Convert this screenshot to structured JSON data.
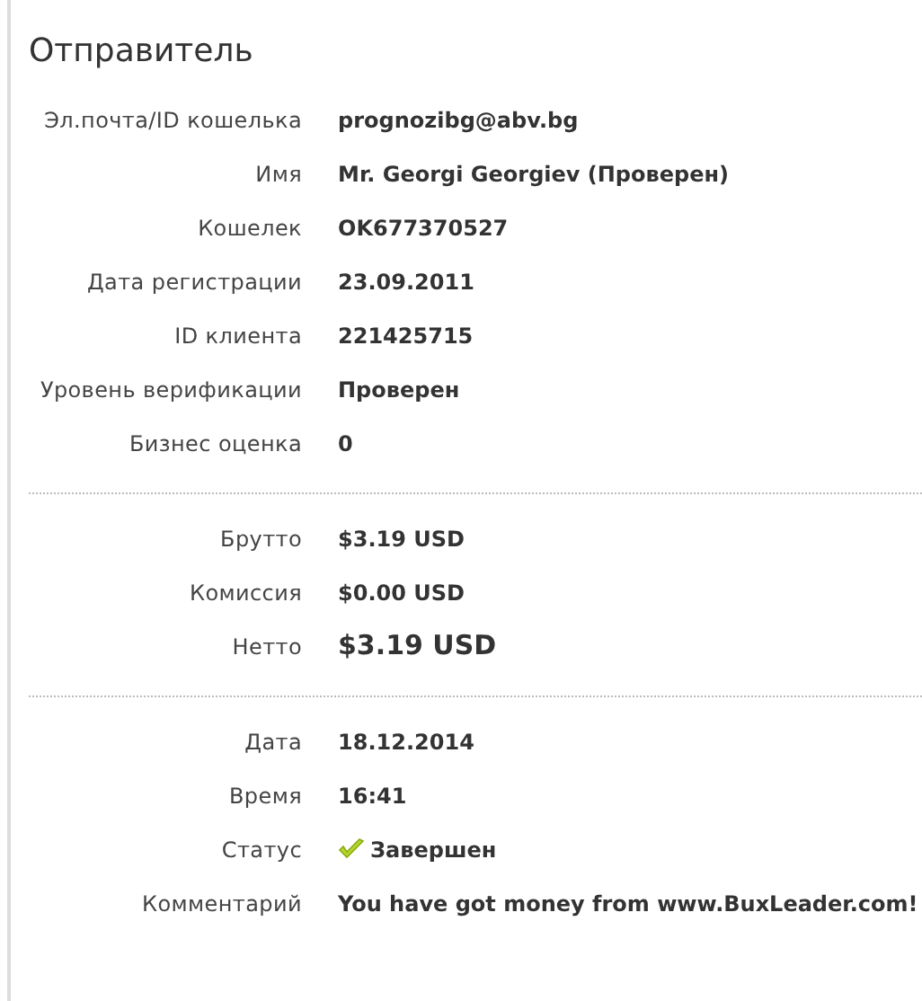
{
  "title": "Отправитель",
  "sections": [
    {
      "rows": [
        {
          "label": "Эл.почта/ID кошелька",
          "value": "prognozibg@abv.bg",
          "kind": "text"
        },
        {
          "label": "Имя",
          "value": "Mr. Georgi Georgiev (Проверен)",
          "kind": "text"
        },
        {
          "label": "Кошелек",
          "value": "OK677370527",
          "kind": "text"
        },
        {
          "label": "Дата регистрации",
          "value": "23.09.2011",
          "kind": "text"
        },
        {
          "label": "ID клиента",
          "value": "221425715",
          "kind": "text"
        },
        {
          "label": "Уровень верификации",
          "value": "Проверен",
          "kind": "text"
        },
        {
          "label": "Бизнес оценка",
          "value": "0",
          "kind": "text"
        }
      ]
    },
    {
      "rows": [
        {
          "label": "Брутто",
          "value": "$3.19 USD",
          "kind": "text"
        },
        {
          "label": "Комиссия",
          "value": "$0.00 USD",
          "kind": "text"
        },
        {
          "label": "Нетто",
          "value": "$3.19 USD",
          "kind": "large"
        }
      ]
    },
    {
      "rows": [
        {
          "label": "Дата",
          "value": "18.12.2014",
          "kind": "text"
        },
        {
          "label": "Время",
          "value": "16:41",
          "kind": "text"
        },
        {
          "label": "Статус",
          "value": "Завершен",
          "kind": "status"
        },
        {
          "label": "Комментарий",
          "value": "You have got money from www.BuxLeader.com!",
          "kind": "text"
        }
      ]
    }
  ]
}
